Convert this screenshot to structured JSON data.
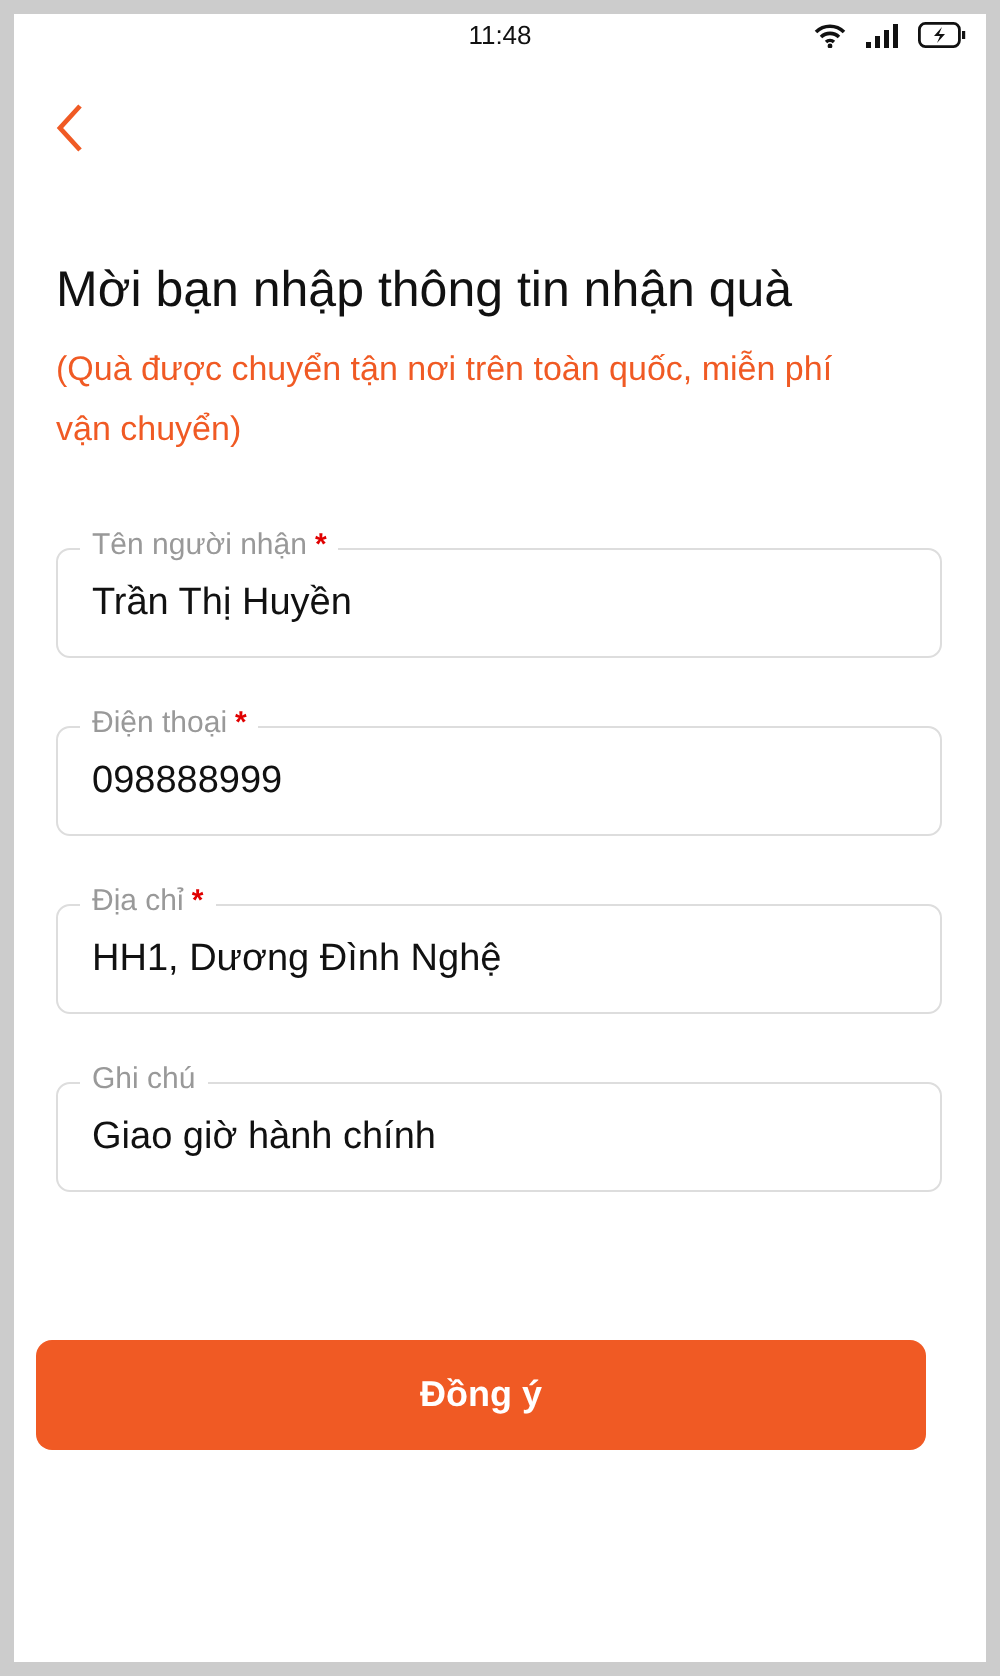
{
  "status_bar": {
    "time": "11:48"
  },
  "title": "Mời bạn nhập thông tin nhận quà",
  "subtitle": "(Quà được chuyển tận nơi trên toàn quốc, miễn phí vận chuyển)",
  "fields": [
    {
      "label": "Tên người nhận",
      "required_mark": "*",
      "value": "Trần Thị Huyền"
    },
    {
      "label": "Điện thoại",
      "required_mark": "*",
      "value": "098888999"
    },
    {
      "label": "Địa chỉ",
      "required_mark": "*",
      "value": "HH1, Dương Đình Nghệ"
    },
    {
      "label": "Ghi chú",
      "value": "Giao giờ hành chính"
    }
  ],
  "submit_button": "Đồng ý"
}
